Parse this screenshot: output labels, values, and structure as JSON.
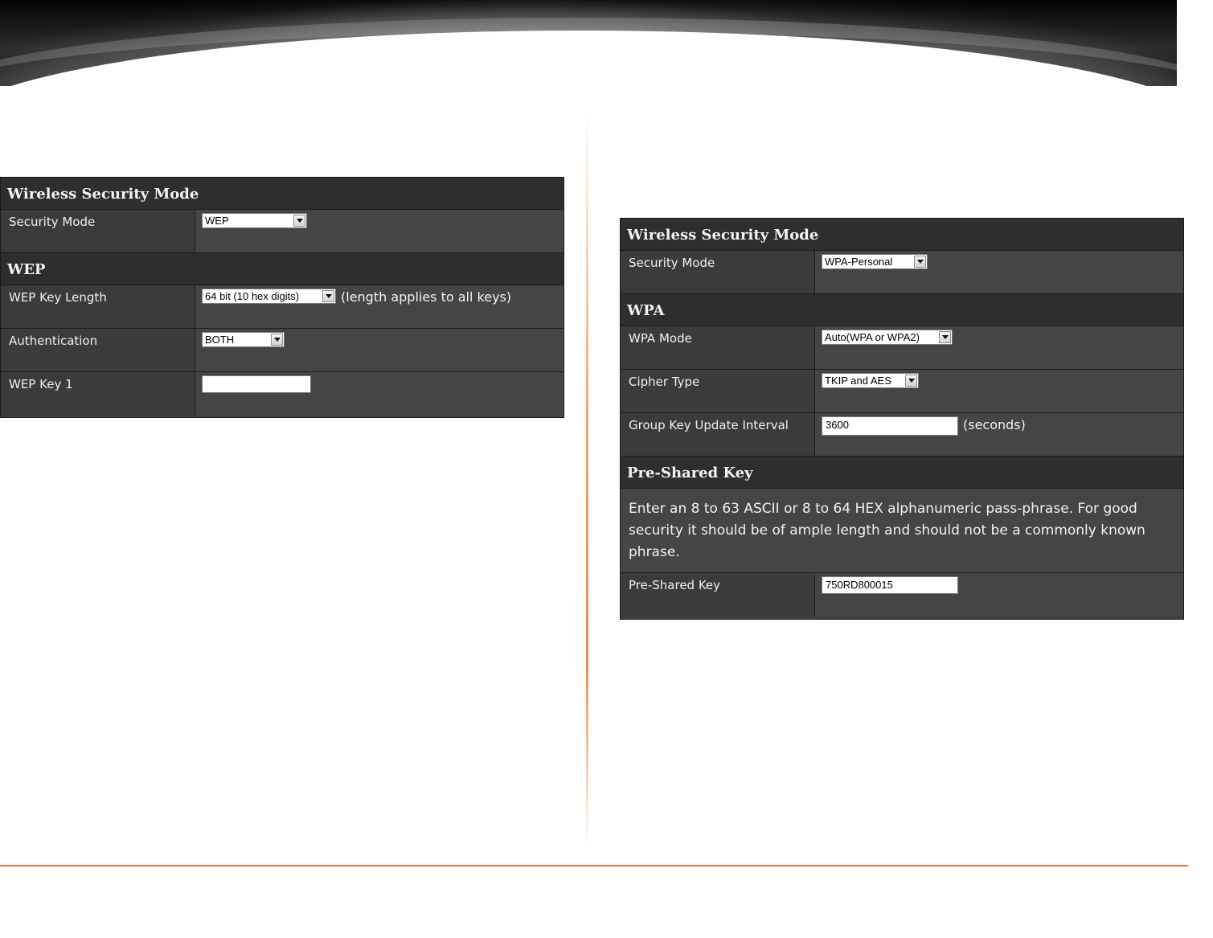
{
  "left_panel": {
    "header": "Wireless Security Mode",
    "security_mode_label": "Security Mode",
    "security_mode_value": "WEP",
    "wep_header": "WEP",
    "key_length_label": "WEP Key Length",
    "key_length_value": "64 bit (10 hex digits)",
    "key_length_note": "(length applies to all keys)",
    "auth_label": "Authentication",
    "auth_value": "BOTH",
    "key1_label": "WEP Key 1",
    "key1_value": ""
  },
  "right_panel": {
    "header": "Wireless Security Mode",
    "security_mode_label": "Security Mode",
    "security_mode_value": "WPA-Personal",
    "wpa_header": "WPA",
    "wpa_mode_label": "WPA Mode",
    "wpa_mode_value": "Auto(WPA or WPA2)",
    "cipher_label": "Cipher Type",
    "cipher_value": "TKIP and AES",
    "group_key_label": "Group Key Update Interval",
    "group_key_value": "3600",
    "group_key_unit": "(seconds)",
    "psk_header": "Pre-Shared Key",
    "psk_description": "Enter an 8 to 63 ASCII or 8 to 64 HEX alphanumeric pass-phrase. For good security it should be of ample length and should not be a commonly known phrase.",
    "psk_label": "Pre-Shared Key",
    "psk_value": "750RD800015"
  },
  "colors": {
    "accent": "#e8722f",
    "panel_bg": "#3f3f3f",
    "header_bg": "#2e2e2e"
  },
  "icons": [
    "dropdown-arrow-icon"
  ]
}
